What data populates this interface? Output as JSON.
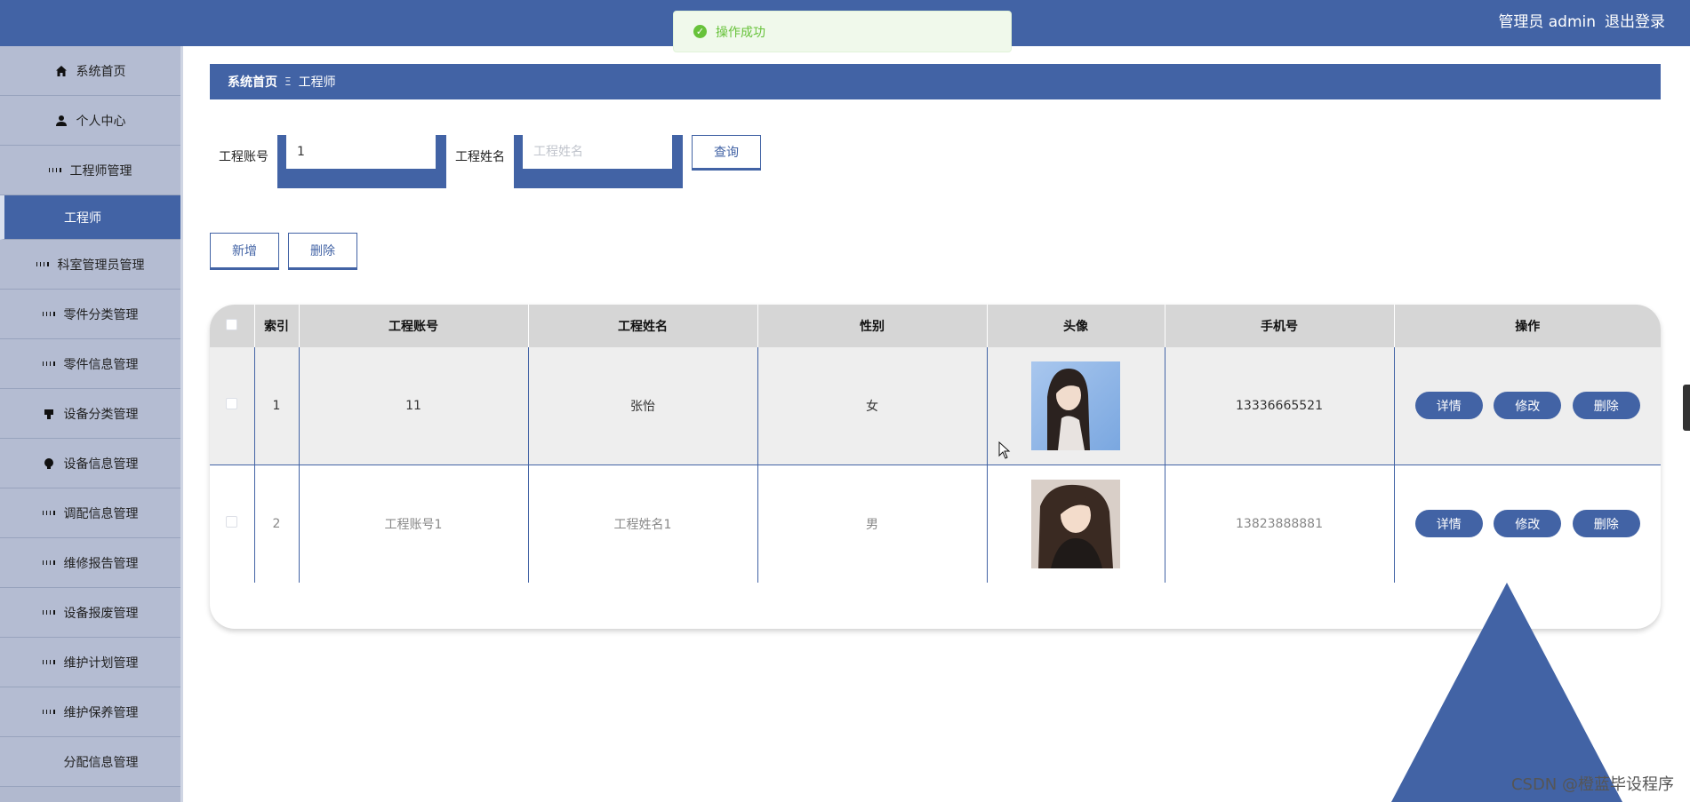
{
  "header": {
    "user_label": "管理员 admin",
    "logout_label": "退出登录"
  },
  "toast": {
    "message": "操作成功"
  },
  "sidebar": {
    "items": [
      {
        "label": "系统首页",
        "icon": "home-icon"
      },
      {
        "label": "个人中心",
        "icon": "user-icon"
      },
      {
        "label": "工程师管理",
        "icon": "grid-icon"
      },
      {
        "label": "工程师",
        "icon": "",
        "active": true
      },
      {
        "label": "科室管理员管理",
        "icon": "grid-icon"
      },
      {
        "label": "零件分类管理",
        "icon": "grid-icon"
      },
      {
        "label": "零件信息管理",
        "icon": "grid-icon"
      },
      {
        "label": "设备分类管理",
        "icon": "stamp-icon"
      },
      {
        "label": "设备信息管理",
        "icon": "bulb-icon"
      },
      {
        "label": "调配信息管理",
        "icon": "grid-icon"
      },
      {
        "label": "维修报告管理",
        "icon": "grid-icon"
      },
      {
        "label": "设备报废管理",
        "icon": "grid-icon"
      },
      {
        "label": "维护计划管理",
        "icon": "grid-icon"
      },
      {
        "label": "维护保养管理",
        "icon": "grid-icon"
      },
      {
        "label": "分配信息管理",
        "icon": "apps-icon"
      }
    ]
  },
  "breadcrumb": {
    "home": "系统首页",
    "separator": "Ξ",
    "current": "工程师"
  },
  "search": {
    "account_label": "工程账号",
    "account_value": "1",
    "name_label": "工程姓名",
    "name_placeholder": "工程姓名",
    "query_label": "查询"
  },
  "actions": {
    "add_label": "新增",
    "delete_label": "删除"
  },
  "table": {
    "headers": [
      "",
      "索引",
      "工程账号",
      "工程姓名",
      "性别",
      "头像",
      "手机号",
      "操作"
    ],
    "rows": [
      {
        "index": "1",
        "account": "11",
        "name": "张怡",
        "gender": "女",
        "phone": "13336665521"
      },
      {
        "index": "2",
        "account": "工程账号1",
        "name": "工程姓名1",
        "gender": "男",
        "phone": "13823888881"
      }
    ],
    "op_labels": {
      "detail": "详情",
      "edit": "修改",
      "delete": "删除"
    }
  },
  "watermark": "CSDN @橙蓝毕设程序",
  "colors": {
    "primary": "#4263a5",
    "sidebar": "#b4bcd2",
    "success": "#67c23a"
  }
}
